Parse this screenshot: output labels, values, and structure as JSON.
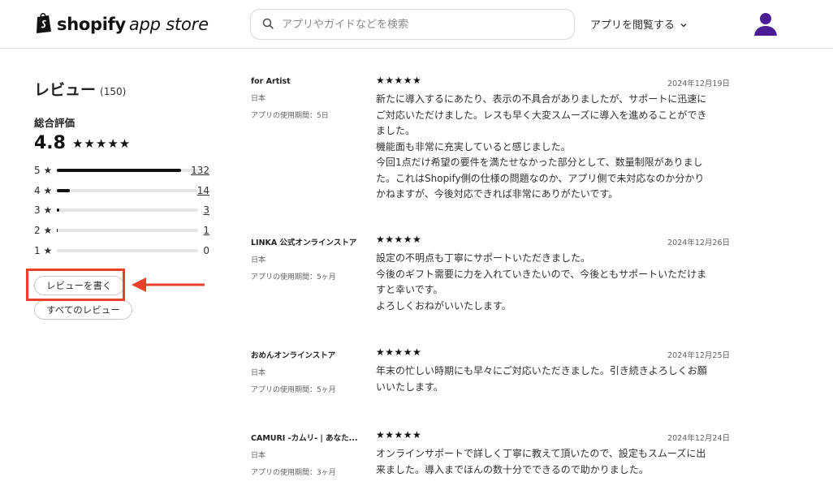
{
  "header": {
    "logo_bold": "shopify",
    "logo_light": "app store",
    "search_placeholder": "アプリやガイドなどを検索",
    "browse_label": "アプリを閲覧する"
  },
  "summary": {
    "title": "レビュー",
    "count": "(150)",
    "overall_label": "総合評価",
    "score": "4.8",
    "stars": "★★★★★",
    "distribution": [
      {
        "label": "5 ★",
        "count": "132",
        "fraction": 0.88
      },
      {
        "label": "4 ★",
        "count": "14",
        "fraction": 0.093
      },
      {
        "label": "3 ★",
        "count": "3",
        "fraction": 0.02
      },
      {
        "label": "2 ★",
        "count": "1",
        "fraction": 0.007
      },
      {
        "label": "1 ★",
        "count": "0",
        "fraction": 0.0
      }
    ],
    "write_review": "レビューを書く",
    "all_reviews": "すべてのレビュー"
  },
  "annotation": {
    "highlight_color": "#e8402a"
  },
  "reviews": [
    {
      "name": "for Artist",
      "country": "日本",
      "usage": "アプリの使用期間：5日",
      "stars": "★★★★★",
      "date": "2024年12月19日",
      "body": [
        "新たに導入するにあたり、表示の不具合がありましたが、サポートに迅速に",
        "ご対応いただけました。レスも早く大変スムーズに導入を進めることができ",
        "ました。",
        "機能面も非常に充実していると感じました。",
        "今回1点だけ希望の要件を満たせなかった部分として、数量制限がありまし",
        "た。これはShopify側の仕様の問題なのか、アプリ側で未対応なのか分かり",
        "かねますが、今後対応できれば非常にありがたいです。"
      ]
    },
    {
      "name": "LINKA 公式オンラインストア",
      "country": "日本",
      "usage": "アプリの使用期間：5ヶ月",
      "stars": "★★★★★",
      "date": "2024年12月26日",
      "body": [
        "設定の不明点も丁寧にサポートいただきました。",
        "今後のギフト需要に力を入れていきたいので、今後ともサポートいただけま",
        "すと幸いです。",
        "よろしくおねがいいたします。"
      ]
    },
    {
      "name": "おめんオンラインストア",
      "country": "日本",
      "usage": "アプリの使用期間：5ヶ月",
      "stars": "★★★★★",
      "date": "2024年12月25日",
      "body": [
        "年末の忙しい時期にも早々にご対応いただきました。引き続きよろしくお願",
        "いいたします。"
      ]
    },
    {
      "name": "CAMURI -カムリ- | あなた...",
      "country": "日本",
      "usage": "アプリの使用期間：3ヶ月",
      "stars": "★★★★★",
      "date": "2024年12月24日",
      "body": [
        "オンラインサポートで詳しく丁寧に教えて頂いたので、設定もスムーズに出",
        "来ました。導入までほんの数十分でできるので助かりました。"
      ]
    }
  ]
}
